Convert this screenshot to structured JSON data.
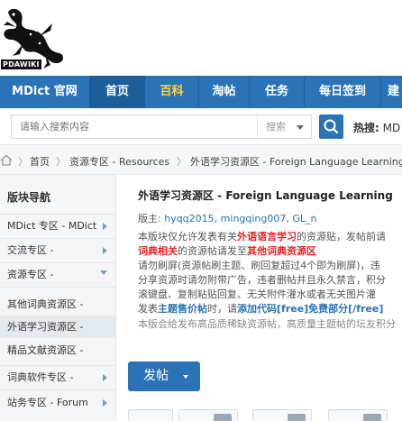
{
  "logo": {
    "text": "PDAWIKI"
  },
  "nav": {
    "items": [
      {
        "label": "MDict 官网"
      },
      {
        "label": "首页"
      },
      {
        "label": "百科"
      },
      {
        "label": "淘帖"
      },
      {
        "label": "任务"
      },
      {
        "label": "每日签到"
      },
      {
        "label": "建"
      }
    ],
    "active_index": 1,
    "highlight_index": 2
  },
  "search": {
    "placeholder": "请输入搜索内容",
    "type_label": "搜索",
    "hot_label": "热搜:",
    "hot_first": "MD"
  },
  "breadcrumb": {
    "items": [
      {
        "label": "首页"
      },
      {
        "label": "资源专区 - Resources"
      },
      {
        "label": "外语学习资源区 - Foreign Language Learning"
      }
    ]
  },
  "sidebar": {
    "heading": "版块导航",
    "items": [
      {
        "label": "MDict 专区 - MDict",
        "arrow": true
      },
      {
        "label": "交流专区 -",
        "arrow": true
      },
      {
        "label": "资源专区 -",
        "arrow": true
      },
      {
        "label": "其他词典资源区 -",
        "arrow": false
      },
      {
        "label": "外语学习资源区 -",
        "arrow": false
      },
      {
        "label": "精品文献资源区 -",
        "arrow": false
      },
      {
        "label": "词典软件专区 -",
        "arrow": true
      },
      {
        "label": "站务专区 - Forum",
        "arrow": true
      }
    ]
  },
  "forum": {
    "title": "外语学习资源区 - Foreign Language Learning",
    "mods_label": "版主:",
    "mods": [
      "hyqq2015",
      "mingqing007",
      "GL_n"
    ],
    "rules": {
      "l1a": "本版块仅允许发表有关",
      "l1b": "外语语言学习",
      "l1c": "的资源贴，发帖前请",
      "l2a": "词典相关",
      "l2b": "的资源帖请发至",
      "l2c": "其他词典资源区",
      "l3": "请勿刷屏(资源帖刷主题、刷回复超过4个即为刷屏)，违",
      "l4": "分享资源时请勿附带广告，违者删帖并且永久禁言，积分",
      "l5": "滚键盘、复制粘贴回复、无关附件灌水或者无关图片灌",
      "l6a": "发表",
      "l6b": "主题售价帖",
      "l6c": "时，请",
      "l6d": "添加代码[free]免费部分[/free]",
      "l7": "本版会给发布高品质稀缺资源帖，高质量主题帖的坛友积分"
    },
    "post_button": "发帖"
  },
  "colors": {
    "nav_bg": "#2b73b7",
    "nav_active": "#1d5d99",
    "nav_highlight": "#ffd84a",
    "rule_red": "#e52424",
    "link_blue": "#2b73b7"
  }
}
